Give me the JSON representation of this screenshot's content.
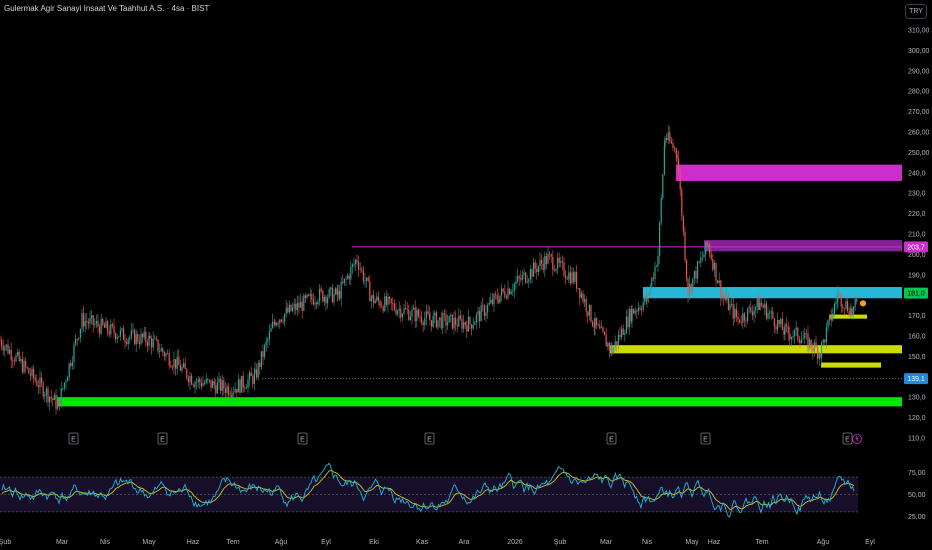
{
  "header": {
    "title": "Gulermak Agir Sanayi Insaat Ve Taahhut A.S. · 4sa · BIST",
    "currency": "TRY"
  },
  "colors": {
    "background": "#000000",
    "up": "#26a69a",
    "down": "#ef5350",
    "green_zone": "#00e600",
    "cyan_zone": "#26b7d4",
    "yellow_zone": "#cddc00",
    "magenta_zone": "#cc2ecc",
    "purple_zone": "#9c27b0",
    "rsi_line": "#1fb6d6",
    "rsi_ma": "#d4c21a"
  },
  "chart_data": {
    "type": "candlestick",
    "symbol": "Gulermak Agir Sanayi Insaat Ve Taahhut A.S.",
    "interval": "4sa",
    "exchange": "BIST",
    "y_ticks": [
      "310,00",
      "300,00",
      "290,00",
      "280,00",
      "270,00",
      "260,00",
      "250,00",
      "240,0",
      "230,0",
      "220,0",
      "210,0",
      "200,0",
      "190,0",
      "180,0",
      "170,0",
      "160,0",
      "150,0",
      "140,0",
      "130,0",
      "120,0",
      "110,0"
    ],
    "x_ticks": [
      "Şub",
      "Mar",
      "Nis",
      "May",
      "Haz",
      "Tem",
      "Ağu",
      "Eyl",
      "Eki",
      "Kas",
      "Ara",
      "2026",
      "Şub",
      "Mar",
      "Nis",
      "May",
      "Haz",
      "Tem",
      "Ağu",
      "Eyl"
    ],
    "price_tags": [
      {
        "value": "203,7",
        "kind": "purple"
      },
      {
        "value": "181,0",
        "kind": "green"
      },
      {
        "value": "139,1",
        "kind": "blue"
      }
    ],
    "price_path": [
      [
        "Şub",
        158
      ],
      [
        "Mar",
        126
      ],
      [
        "Mar",
        168
      ],
      [
        "Nis",
        160
      ],
      [
        "May",
        158
      ],
      [
        "Haz",
        138
      ],
      [
        "Tem",
        134
      ],
      [
        "Tem",
        140
      ],
      [
        "Ağu",
        168
      ],
      [
        "Eyl",
        180
      ],
      [
        "Eki",
        180
      ],
      [
        "Kas",
        198
      ],
      [
        "Kas",
        178
      ],
      [
        "Ara",
        168
      ],
      [
        "Ara",
        166
      ],
      [
        "2026",
        180
      ],
      [
        "2026",
        198
      ],
      [
        "Şub",
        188
      ],
      [
        "Şub",
        165
      ],
      [
        "Mar",
        153
      ],
      [
        "Mar",
        172
      ],
      [
        "Nis",
        178
      ],
      [
        "Nis",
        200
      ],
      [
        "Nis",
        258
      ],
      [
        "Nis",
        250
      ],
      [
        "May",
        182
      ],
      [
        "May",
        205
      ],
      [
        "May",
        180
      ],
      [
        "Haz",
        168
      ],
      [
        "Haz",
        176
      ],
      [
        "Tem",
        162
      ],
      [
        "Tem",
        160
      ],
      [
        "Ağu",
        152
      ],
      [
        "Ağu",
        180
      ],
      [
        "Ağu",
        172
      ],
      [
        "Eyl",
        176
      ]
    ],
    "zones": [
      {
        "name": "green",
        "low": 125.5,
        "high": 130.0,
        "from": "Mar",
        "to": "Eyl"
      },
      {
        "name": "yellow",
        "low": 151.5,
        "high": 155.5,
        "from": "Mar",
        "to": "Eyl"
      },
      {
        "name": "yellow-small",
        "low": 144.5,
        "high": 147.0,
        "from": "Ağu",
        "to": "Eyl"
      },
      {
        "name": "yellow-mini",
        "low": 168.5,
        "high": 170.5,
        "from": "Ağu",
        "to": "Eyl"
      },
      {
        "name": "cyan",
        "low": 178.5,
        "high": 184.0,
        "from": "Nis",
        "to": "Eyl"
      },
      {
        "name": "purple",
        "low": 201.5,
        "high": 207.0,
        "from": "May",
        "to": "Eyl"
      },
      {
        "name": "magenta",
        "low": 236.0,
        "high": 244.0,
        "from": "May",
        "to": "Eyl"
      }
    ],
    "lines": [
      {
        "name": "resistance",
        "value": 203.7,
        "color": "#cc2ecc"
      },
      {
        "name": "support-dotted",
        "value": 139.1,
        "color": "#26a69a"
      }
    ],
    "events": [
      "E",
      "E",
      "E",
      "E",
      "E",
      "E",
      "E"
    ],
    "rsi": {
      "ticks": [
        "75,00",
        "50,00",
        "25,00"
      ],
      "overbought": 70,
      "oversold": 30
    }
  }
}
